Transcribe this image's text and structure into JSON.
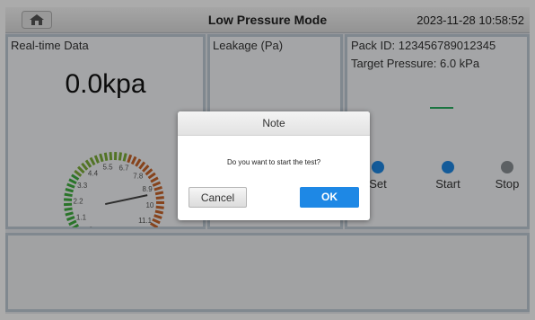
{
  "header": {
    "title": "Low Pressure Mode",
    "datetime": "2023-11-28 10:58:52"
  },
  "realtime": {
    "title": "Real-time Data",
    "reading": "0.0kpa",
    "gauge": {
      "min": 0,
      "max": 11.1,
      "value": 0.0,
      "ticks": [
        "0",
        "1.1",
        "2.2",
        "3.3",
        "4.4",
        "5.5",
        "6.7",
        "7.8",
        "8.9",
        "10",
        "11.1"
      ]
    }
  },
  "leakage": {
    "title": "Leakage (Pa)"
  },
  "pack": {
    "pack_id": "Pack ID: 123456789012345",
    "target": "Target Pressure: 6.0 kPa",
    "result": "----",
    "controls": [
      {
        "label": "Set",
        "color": "#1e88e5"
      },
      {
        "label": "Start",
        "color": "#1e88e5"
      },
      {
        "label": "Stop",
        "color": "#8a8f94"
      }
    ]
  },
  "dialog": {
    "title": "Note",
    "message": "Do you want to start the test?",
    "cancel": "Cancel",
    "ok": "OK"
  }
}
